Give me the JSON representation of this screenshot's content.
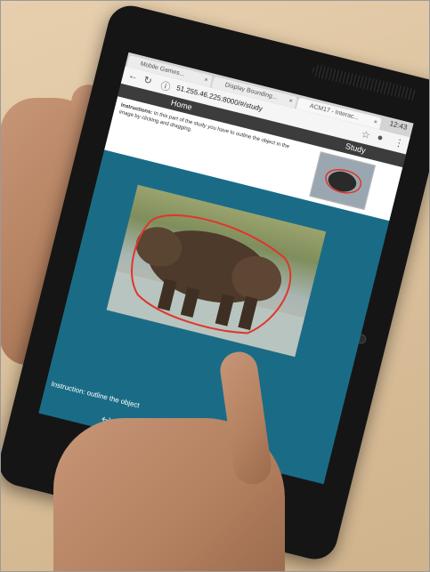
{
  "browser": {
    "tabs": [
      {
        "label": "Mobile Games..."
      },
      {
        "label": "Display Bounding..."
      },
      {
        "label": "ACM17 - Interac..."
      }
    ],
    "url": "51.255.46.225:8000/#/study",
    "time": "12:43"
  },
  "page": {
    "nav_home": "Home",
    "nav_study": "Study",
    "instructions_label": "Instructions:",
    "instructions_text": "In this part of the study you have to outline the object in the image by clicking and dragging.",
    "caption": "Instruction: outline the object"
  },
  "icons": {
    "back": "arrow-left-icon",
    "refresh": "refresh-icon",
    "info": "info-icon",
    "star": "star-icon",
    "mic": "microphone-icon",
    "menu": "more-vert-icon",
    "tab_favicon": "globe-icon"
  },
  "colors": {
    "screen_background": "#1a6c86",
    "navbar": "#3c3c3c",
    "outline_stroke": "#e0352b"
  }
}
